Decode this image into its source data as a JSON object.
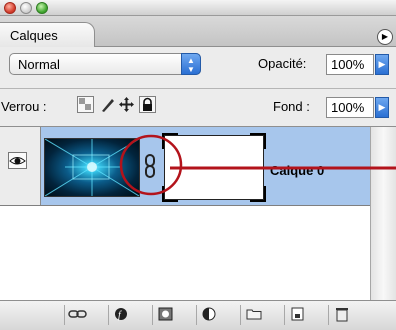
{
  "panel": {
    "tab_title": "Calques",
    "blend_mode": "Normal",
    "opacity_label": "Opacité:",
    "opacity_value": "100%",
    "lock_label": "Verrou :",
    "fill_label": "Fond :",
    "fill_value": "100%"
  },
  "layers": [
    {
      "name": "Calque 0",
      "visible": true,
      "selected": true,
      "has_mask": true,
      "linked": true
    }
  ],
  "annotation": {
    "color": "#b3131b"
  },
  "icons": {
    "lock_buttons": [
      "lock-transparent-pixels-icon",
      "lock-image-pixels-icon",
      "lock-position-icon",
      "lock-all-icon"
    ],
    "bottom_buttons": [
      "link-layers-icon",
      "layer-style-icon",
      "add-mask-icon",
      "adjustment-layer-icon",
      "new-group-icon",
      "new-layer-icon",
      "delete-layer-icon"
    ]
  },
  "colors": {
    "selection": "#a7c6ec",
    "accent": "#2a6fd3"
  }
}
